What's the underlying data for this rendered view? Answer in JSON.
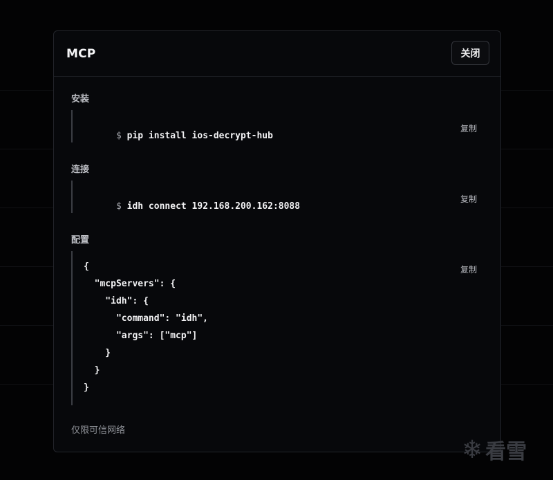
{
  "modal": {
    "title": "MCP",
    "close_label": "关闭"
  },
  "sections": {
    "install": {
      "label": "安装",
      "prompt": "$",
      "command": "pip install ios-decrypt-hub",
      "copy_label": "复制"
    },
    "connect": {
      "label": "连接",
      "prompt": "$",
      "command": "idh connect 192.168.200.162:8088",
      "copy_label": "复制"
    },
    "config": {
      "label": "配置",
      "copy_label": "复制",
      "lines": [
        "{",
        "  \"mcpServers\": {",
        "    \"idh\": {",
        "      \"command\": \"idh\",",
        "      \"args\": [\"mcp\"]",
        "    }",
        "  }",
        "}"
      ]
    }
  },
  "footer_note": "仅限可信网络",
  "watermark": {
    "text": "看雪",
    "icon": "snowflake-icon"
  }
}
